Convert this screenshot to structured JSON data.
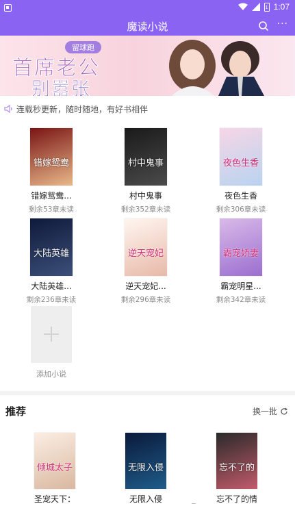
{
  "status_bar": {
    "time": "1:07",
    "battery_level": "1"
  },
  "app_bar": {
    "title": "魔读小说"
  },
  "banner": {
    "tag": "留球跑",
    "line1": "首席老公",
    "line2": "别嚣张"
  },
  "notice": {
    "text": "连载秒更新，随时随地，有好书相伴"
  },
  "shelf": {
    "books": [
      {
        "name": "错嫁鸳鸯...",
        "progress": "剩余53章未读",
        "cover_text": "错嫁鸳鸯",
        "cover_colors": [
          "#7a1414",
          "#e8b98a"
        ]
      },
      {
        "name": "村中鬼事",
        "progress": "剩余352章未读",
        "cover_text": "村中鬼事",
        "cover_colors": [
          "#1a1a1a",
          "#4b4b4b"
        ]
      },
      {
        "name": "夜色生香",
        "progress": "剩余306章未读",
        "cover_text": "夜色生香",
        "cover_colors": [
          "#f6d6e6",
          "#b9d3f0"
        ]
      },
      {
        "name": "大陆英雄...",
        "progress": "剩余236章未读",
        "cover_text": "大陆英雄",
        "cover_colors": [
          "#0f1a3a",
          "#3c4f7a"
        ]
      },
      {
        "name": "逆天宠妃...",
        "progress": "剩余296章未读",
        "cover_text": "逆天宠妃",
        "cover_colors": [
          "#fff6f0",
          "#e7b9a9"
        ]
      },
      {
        "name": "霸宠明星...",
        "progress": "剩余342章未读",
        "cover_text": "霸宠娇妻",
        "cover_colors": [
          "#d9b9e8",
          "#9a6fd0"
        ]
      }
    ],
    "add_label": "添加小说"
  },
  "recommend": {
    "title": "推荐",
    "refresh_label": "换一批",
    "books": [
      {
        "name": "圣宠天下：",
        "cover_text": "倾城太子",
        "cover_colors": [
          "#fbeee3",
          "#d9b8a0"
        ]
      },
      {
        "name": "无限入侵",
        "cover_text": "无限入侵",
        "cover_colors": [
          "#0a1a3a",
          "#1f5c8a"
        ]
      },
      {
        "name": "忘不了的情",
        "cover_text": "忘不了的",
        "cover_colors": [
          "#2a2a2a",
          "#c25a6a"
        ]
      }
    ]
  },
  "colors": {
    "primary": "#8a63f2",
    "divider": "#f2f2f2",
    "muted_text": "#8a8a8a"
  }
}
